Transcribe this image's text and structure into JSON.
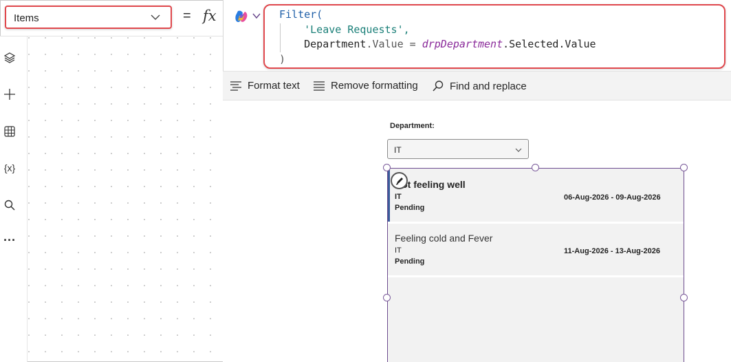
{
  "property_dropdown": {
    "value": "Items"
  },
  "formula_bar": {
    "equals": "=",
    "fx": "fx",
    "code": {
      "line1_fn": "Filter(",
      "line2_str": "'Leave Requests',",
      "line3_a": "Department",
      "line3_b": ".Value = ",
      "line3_ctrl": "drpDepartment",
      "line3_c": ".Selected.Value",
      "line4": ")"
    }
  },
  "left_rail": {
    "icons": [
      "layers-icon",
      "add-icon",
      "table-icon",
      "variables-icon",
      "search-icon",
      "more-icon"
    ],
    "variables_glyph": "{x}",
    "more_glyph": "···"
  },
  "toolbar": {
    "format_text": "Format text",
    "remove_formatting": "Remove formatting",
    "find_replace": "Find and replace"
  },
  "canvas": {
    "department_label": "Department:",
    "department_value": "IT",
    "gallery": [
      {
        "title": "Not feeling well",
        "department": "IT",
        "dates": "06-Aug-2026 - 09-Aug-2026",
        "status": "Pending"
      },
      {
        "title": "Feeling cold and Fever",
        "department": "IT",
        "dates": "11-Aug-2026 - 13-Aug-2026",
        "status": "Pending"
      }
    ]
  },
  "colors": {
    "highlight_border": "#e0474c",
    "selection_border": "#6b4a8e",
    "selected_bar": "#3a5a9a",
    "code_function": "#1f5fa8",
    "code_string": "#1a7f78",
    "code_control": "#8a2a9a"
  }
}
